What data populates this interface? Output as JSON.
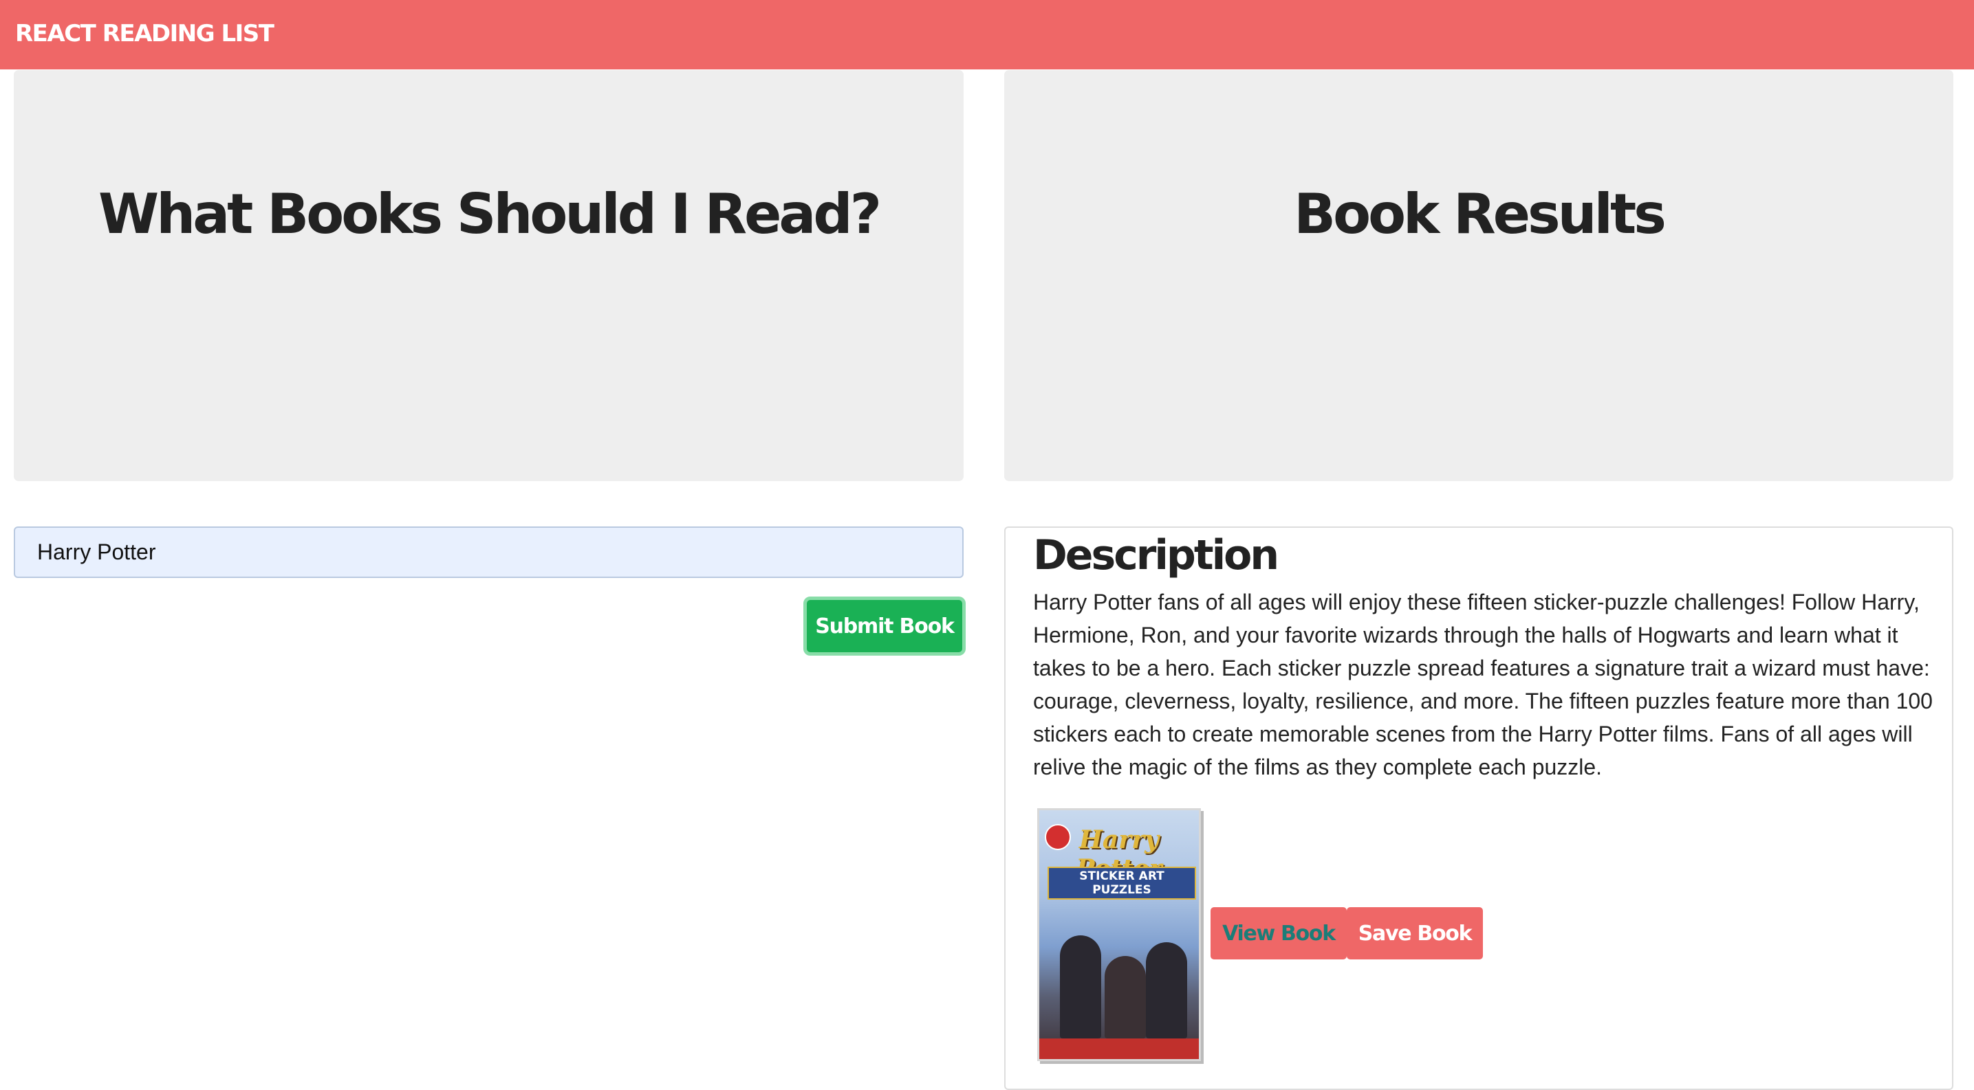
{
  "navbar": {
    "brand": "REACT READING LIST"
  },
  "search_panel": {
    "heading": "What Books Should I Read?",
    "input_value": "Harry Potter",
    "submit_label": "Submit Book"
  },
  "results_panel": {
    "heading": "Book Results"
  },
  "result": {
    "description_heading": "Description",
    "description": "Harry Potter fans of all ages will enjoy these fifteen sticker-puzzle challenges! Follow Harry, Hermione, Ron, and your favorite wizards through the halls of Hogwarts and learn what it takes to be a hero. Each sticker puzzle spread features a signature trait a wizard must have: courage, cleverness, loyalty, resilience, and more. The fifteen puzzles feature more than 100 stickers each to create memorable scenes from the Harry Potter films. Fans of all ages will relive the magic of the films as they complete each puzzle.",
    "cover_title": "Harry Potter",
    "cover_subtitle": "STICKER ART PUZZLES",
    "view_label": "View Book",
    "save_label": "Save Book"
  },
  "colors": {
    "navbar": "#ef6767",
    "jumbotron": "#eeeeee",
    "submit": "#1ab155",
    "action": "#ef6767"
  }
}
